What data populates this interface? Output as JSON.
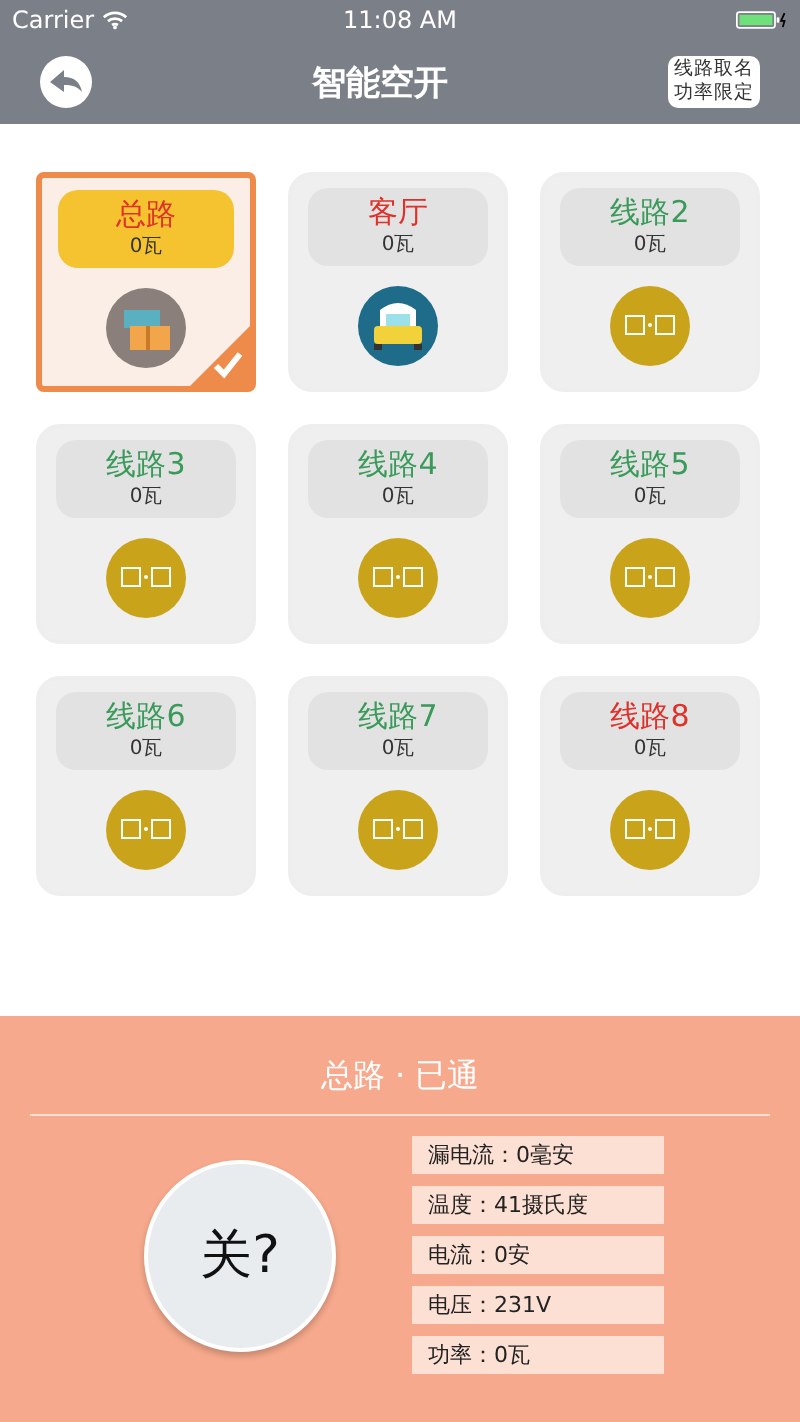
{
  "status_bar": {
    "carrier": "Carrier",
    "time": "11:08 AM"
  },
  "nav": {
    "title": "智能空开",
    "action": [
      "线路取名",
      "功率限定"
    ]
  },
  "tiles": [
    {
      "name": "总路",
      "power": "0瓦",
      "kind": "main",
      "color": "#e0302a",
      "selected": true
    },
    {
      "name": "客厅",
      "power": "0瓦",
      "kind": "room",
      "color": "#e0302a",
      "selected": false
    },
    {
      "name": "线路2",
      "power": "0瓦",
      "kind": "switch",
      "color": "#3a9a5a",
      "selected": false
    },
    {
      "name": "线路3",
      "power": "0瓦",
      "kind": "switch",
      "color": "#3a9a5a",
      "selected": false
    },
    {
      "name": "线路4",
      "power": "0瓦",
      "kind": "switch",
      "color": "#3a9a5a",
      "selected": false
    },
    {
      "name": "线路5",
      "power": "0瓦",
      "kind": "switch",
      "color": "#3a9a5a",
      "selected": false
    },
    {
      "name": "线路6",
      "power": "0瓦",
      "kind": "switch",
      "color": "#3a9a5a",
      "selected": false
    },
    {
      "name": "线路7",
      "power": "0瓦",
      "kind": "switch",
      "color": "#3a9a5a",
      "selected": false
    },
    {
      "name": "线路8",
      "power": "0瓦",
      "kind": "switch",
      "color": "#e0302a",
      "selected": false
    }
  ],
  "panel": {
    "title": "总路 · 已通",
    "button": "关?",
    "readings": [
      "漏电流：0毫安",
      "温度：41摄氏度",
      "电流：0安",
      "电压：231V",
      "功率：0瓦"
    ]
  }
}
